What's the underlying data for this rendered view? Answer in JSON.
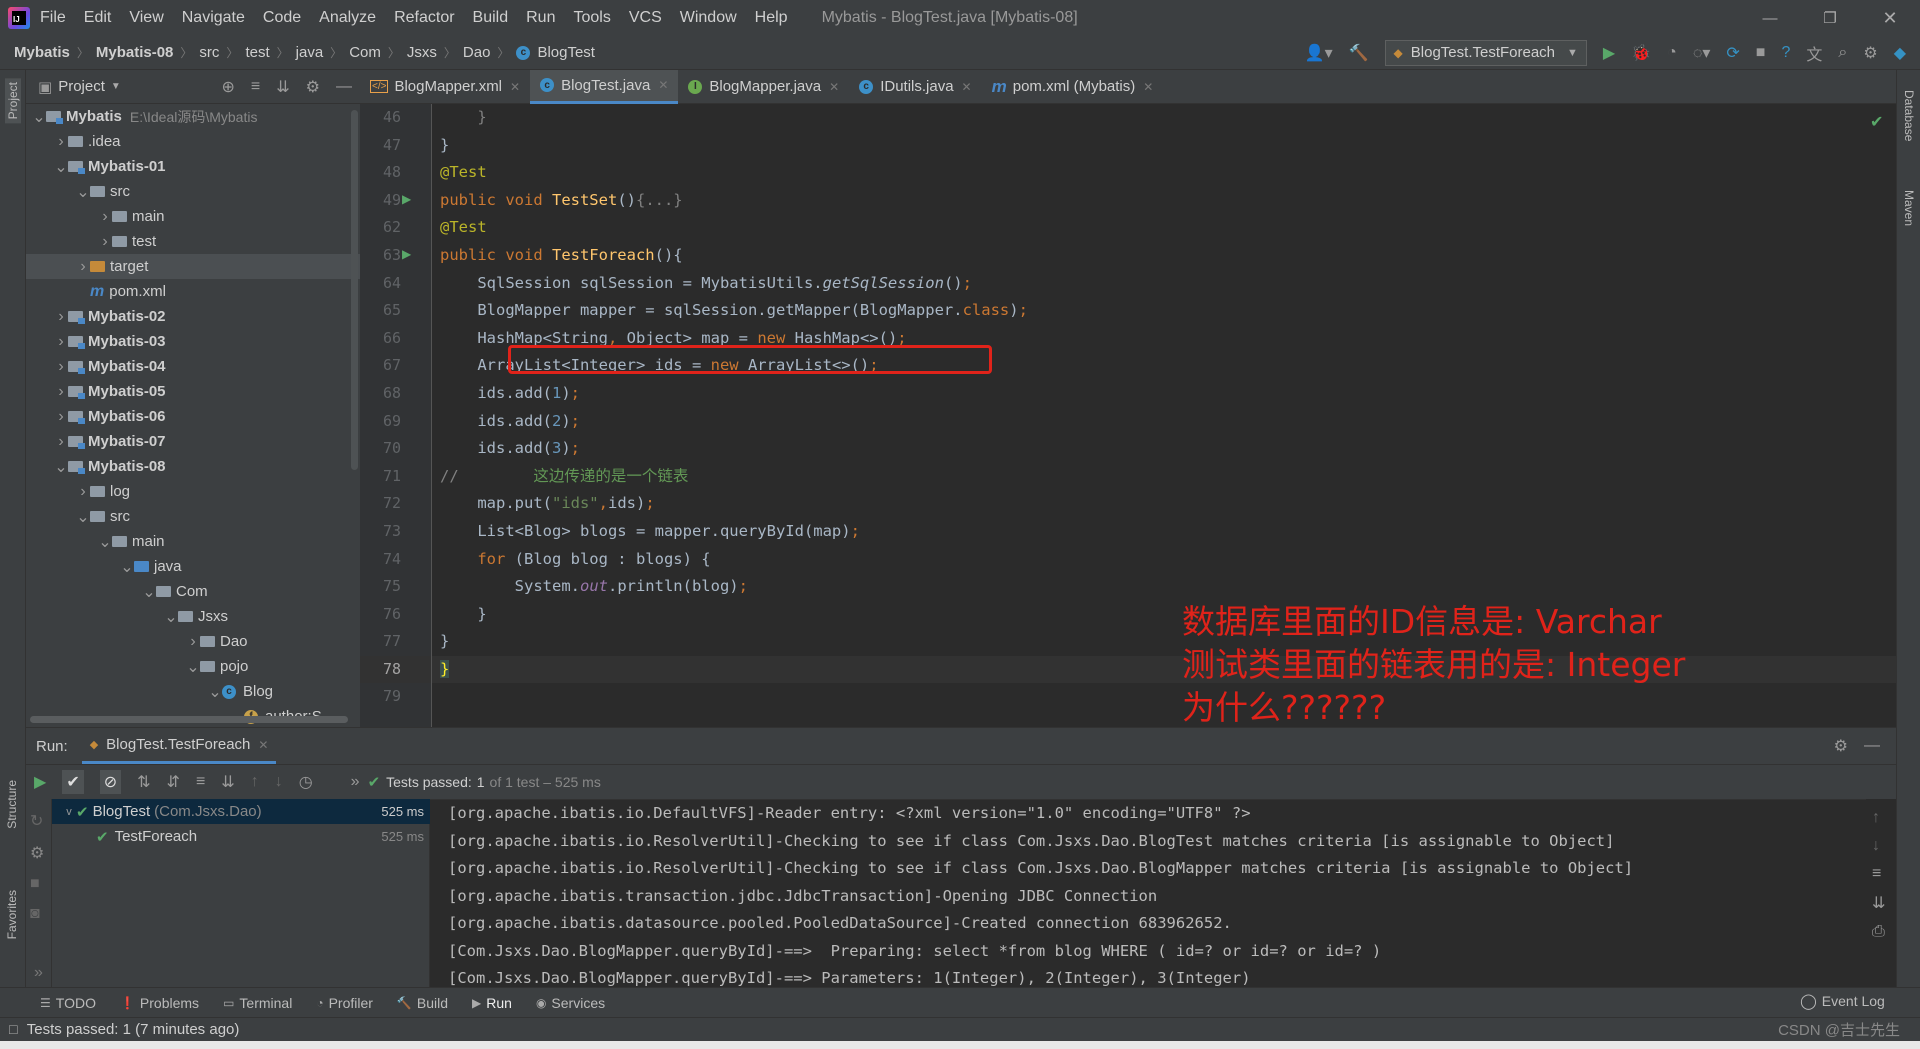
{
  "window": {
    "title": "Mybatis - BlogTest.java [Mybatis-08]",
    "menu": [
      "File",
      "Edit",
      "View",
      "Navigate",
      "Code",
      "Analyze",
      "Refactor",
      "Build",
      "Run",
      "Tools",
      "VCS",
      "Window",
      "Help"
    ]
  },
  "breadcrumb": [
    "Mybatis",
    "Mybatis-08",
    "src",
    "test",
    "java",
    "Com",
    "Jsxs",
    "Dao",
    "BlogTest"
  ],
  "run_config": "BlogTest.TestForeach",
  "project_panel": {
    "title": "Project",
    "tree": [
      {
        "label": "Mybatis",
        "path": "E:\\Ideal源码\\Mybatis",
        "indent": 0,
        "chev": "v",
        "icon": "module",
        "bold": true
      },
      {
        "label": ".idea",
        "indent": 1,
        "chev": ">",
        "icon": "folder"
      },
      {
        "label": "Mybatis-01",
        "indent": 1,
        "chev": "v",
        "icon": "module",
        "bold": true
      },
      {
        "label": "src",
        "indent": 2,
        "chev": "v",
        "icon": "folder"
      },
      {
        "label": "main",
        "indent": 3,
        "chev": ">",
        "icon": "folder"
      },
      {
        "label": "test",
        "indent": 3,
        "chev": ">",
        "icon": "folder"
      },
      {
        "label": "target",
        "indent": 2,
        "chev": ">",
        "icon": "orange",
        "selected": true
      },
      {
        "label": "pom.xml",
        "indent": 2,
        "chev": "",
        "icon": "maven"
      },
      {
        "label": "Mybatis-02",
        "indent": 1,
        "chev": ">",
        "icon": "module",
        "bold": true
      },
      {
        "label": "Mybatis-03",
        "indent": 1,
        "chev": ">",
        "icon": "module",
        "bold": true
      },
      {
        "label": "Mybatis-04",
        "indent": 1,
        "chev": ">",
        "icon": "module",
        "bold": true
      },
      {
        "label": "Mybatis-05",
        "indent": 1,
        "chev": ">",
        "icon": "module",
        "bold": true
      },
      {
        "label": "Mybatis-06",
        "indent": 1,
        "chev": ">",
        "icon": "module",
        "bold": true
      },
      {
        "label": "Mybatis-07",
        "indent": 1,
        "chev": ">",
        "icon": "module",
        "bold": true
      },
      {
        "label": "Mybatis-08",
        "indent": 1,
        "chev": "v",
        "icon": "module",
        "bold": true
      },
      {
        "label": "log",
        "indent": 2,
        "chev": ">",
        "icon": "folder"
      },
      {
        "label": "src",
        "indent": 2,
        "chev": "v",
        "icon": "folder"
      },
      {
        "label": "main",
        "indent": 3,
        "chev": "v",
        "icon": "folder"
      },
      {
        "label": "java",
        "indent": 4,
        "chev": "v",
        "icon": "bluefolder"
      },
      {
        "label": "Com",
        "indent": 5,
        "chev": "v",
        "icon": "package"
      },
      {
        "label": "Jsxs",
        "indent": 6,
        "chev": "v",
        "icon": "package"
      },
      {
        "label": "Dao",
        "indent": 7,
        "chev": ">",
        "icon": "package"
      },
      {
        "label": "pojo",
        "indent": 7,
        "chev": "v",
        "icon": "package"
      },
      {
        "label": "Blog",
        "indent": 8,
        "chev": "v",
        "icon": "class"
      },
      {
        "label": "author:S",
        "indent": 9,
        "chev": "",
        "icon": "field"
      }
    ]
  },
  "tabs": [
    {
      "label": "BlogMapper.xml",
      "icon": "xml",
      "active": false
    },
    {
      "label": "BlogTest.java",
      "icon": "class",
      "active": true
    },
    {
      "label": "BlogMapper.java",
      "icon": "interface",
      "active": false
    },
    {
      "label": "IDutils.java",
      "icon": "class",
      "active": false
    },
    {
      "label": "pom.xml (Mybatis)",
      "icon": "maven",
      "active": false
    }
  ],
  "editor": {
    "line_numbers": [
      "46",
      "47",
      "48",
      "49",
      "62",
      "63",
      "64",
      "65",
      "66",
      "67",
      "68",
      "69",
      "70",
      "71",
      "72",
      "73",
      "74",
      "75",
      "76",
      "77",
      "78",
      "79"
    ],
    "current_line": "78"
  },
  "annotation_note": [
    "数据库里面的ID信息是: Varchar",
    "测试类里面的链表用的是: Integer",
    "为什么??????"
  ],
  "run_panel": {
    "label": "Run:",
    "tab": "BlogTest.TestForeach",
    "status_prefix": "Tests passed:",
    "status_count": "1",
    "status_rest": "of 1 test – 525 ms",
    "tests": [
      {
        "name": "BlogTest",
        "pkg": "(Com.Jsxs.Dao)",
        "time": "525 ms"
      },
      {
        "name": "TestForeach",
        "pkg": "",
        "time": "525 ms"
      }
    ],
    "console": [
      "[org.apache.ibatis.io.DefaultVFS]-Reader entry: <?xml version=\"1.0\" encoding=\"UTF8\" ?>",
      "[org.apache.ibatis.io.ResolverUtil]-Checking to see if class Com.Jsxs.Dao.BlogTest matches criteria [is assignable to Object]",
      "[org.apache.ibatis.io.ResolverUtil]-Checking to see if class Com.Jsxs.Dao.BlogMapper matches criteria [is assignable to Object]",
      "[org.apache.ibatis.transaction.jdbc.JdbcTransaction]-Opening JDBC Connection",
      "[org.apache.ibatis.datasource.pooled.PooledDataSource]-Created connection 683962652.",
      "[Com.Jsxs.Dao.BlogMapper.queryById]-==>  Preparing: select *from blog WHERE ( id=? or id=? or id=? )",
      "[Com.Jsxs.Dao.BlogMapper.queryById]-==> Parameters: 1(Integer), 2(Integer), 3(Integer)"
    ]
  },
  "bottom_tabs": [
    "TODO",
    "Problems",
    "Terminal",
    "Profiler",
    "Build",
    "Run",
    "Services"
  ],
  "event_log": "Event Log",
  "status_text": "Tests passed: 1 (7 minutes ago)",
  "watermark": "CSDN @吉士先生",
  "side_labels": {
    "project": "Project",
    "structure": "Structure",
    "favorites": "Favorites",
    "database": "Database",
    "maven": "Maven"
  }
}
